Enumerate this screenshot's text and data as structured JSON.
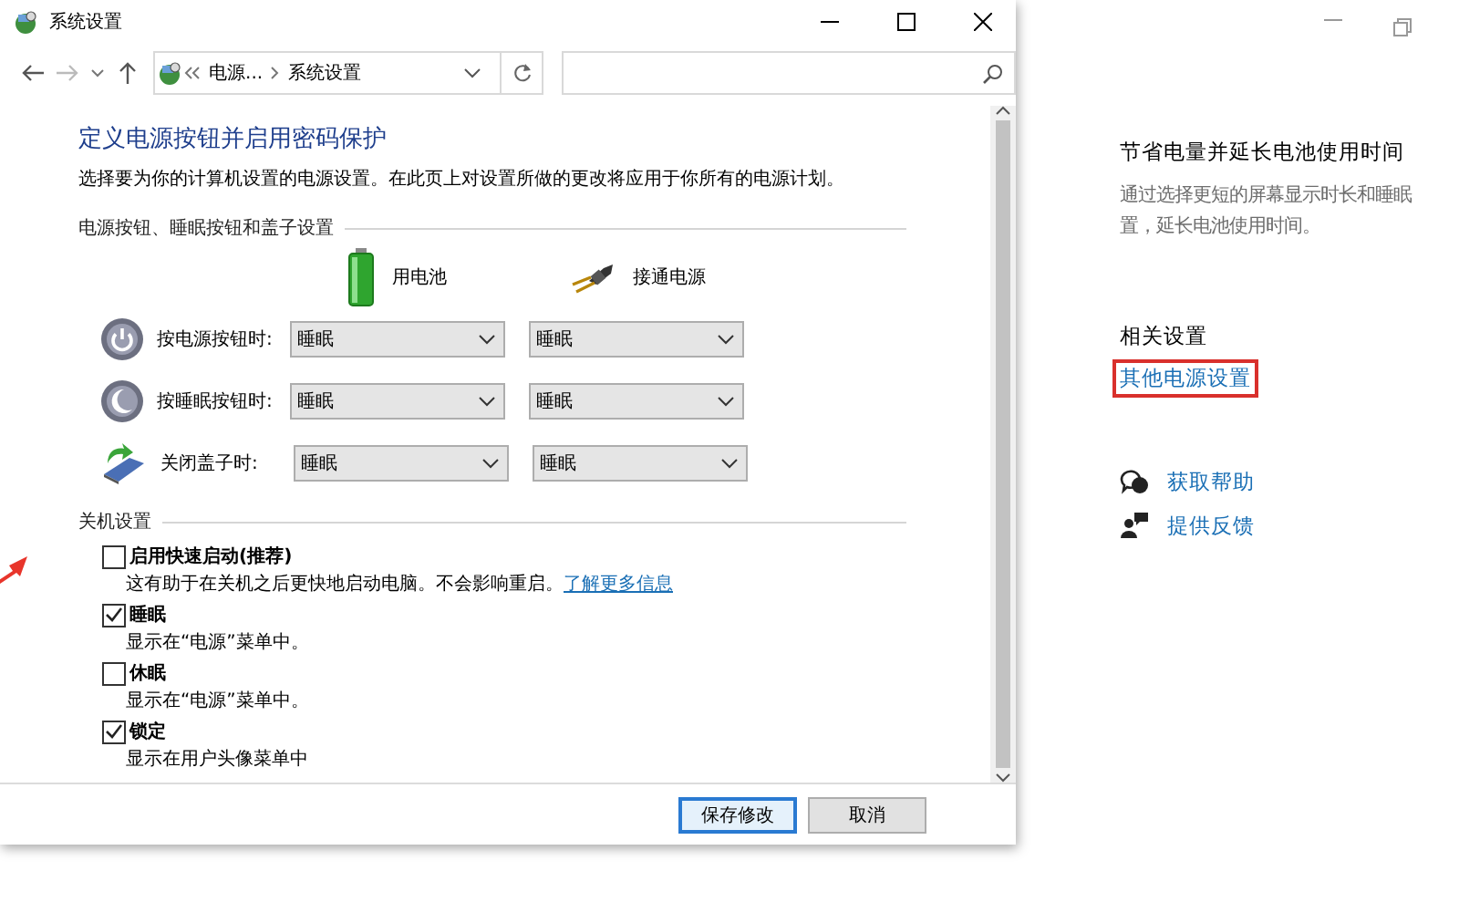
{
  "dialog": {
    "title": "系统设置",
    "address": [
      "电源...",
      "系统设置"
    ],
    "heading": "定义电源按钮并启用密码保护",
    "description": "选择要为你的计算机设置的电源设置。在此页上对设置所做的更改将应用于你所有的电源计划。",
    "buttons_section": {
      "title": "电源按钮、睡眠按钮和盖子设置",
      "columns": [
        {
          "kind": "battery",
          "label": "用电池"
        },
        {
          "kind": "plug",
          "label": "接通电源"
        }
      ],
      "rows": [
        {
          "kind": "power",
          "label": "按电源按钮时:",
          "battery": "睡眠",
          "plugged": "睡眠"
        },
        {
          "kind": "sleep",
          "label": "按睡眠按钮时:",
          "battery": "睡眠",
          "plugged": "睡眠"
        },
        {
          "kind": "lid",
          "label": "关闭盖子时:",
          "battery": "睡眠",
          "plugged": "睡眠"
        }
      ]
    },
    "shutdown": {
      "title": "关机设置",
      "items": [
        {
          "label": "启用快速启动(推荐)",
          "checked": false,
          "description": "这有助于在关机之后更快地启动电脑。不会影响重启。",
          "link": "了解更多信息"
        },
        {
          "label": "睡眠",
          "checked": true,
          "description": "显示在“电源”菜单中。"
        },
        {
          "label": "休眠",
          "checked": false,
          "description": "显示在“电源”菜单中。"
        },
        {
          "label": "锁定",
          "checked": true,
          "description": "显示在用户头像菜单中"
        }
      ]
    },
    "buttons": [
      {
        "label": "保存修改",
        "default": true
      },
      {
        "label": "取消",
        "default": false
      }
    ]
  },
  "panel": {
    "title": "节省电量并延长电池使用时间",
    "description_lines": [
      "通过选择更短的屏幕显示时长和睡眠",
      "置，延长电池使用时间。"
    ],
    "related_title": "相关设置",
    "related_link": {
      "label": "其他电源设置",
      "highlighted": true
    },
    "support_links": [
      {
        "kind": "help",
        "label": "获取帮助"
      },
      {
        "kind": "feedback",
        "label": "提供反馈"
      }
    ]
  }
}
